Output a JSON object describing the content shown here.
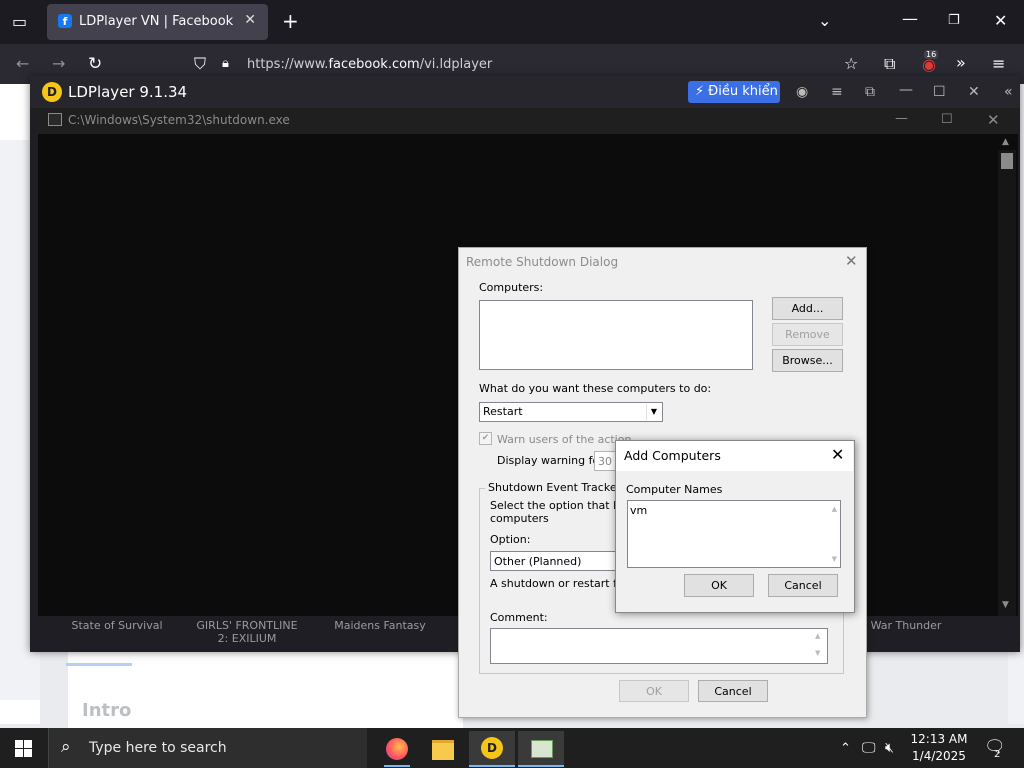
{
  "browser": {
    "tab_title": "LDPlayer VN | Facebook",
    "url_prefix": "https://www.",
    "url_domain": "facebook.com",
    "url_path": "/vi.ldplayer",
    "extension_badge": "16"
  },
  "facebook": {
    "intro_label": "Intro"
  },
  "ldplayer": {
    "title": "LDPlayer 9.1.34",
    "control_button": "Điều khiển",
    "console_title": "C:\\Windows\\System32\\shutdown.exe",
    "games": [
      "State of Survival",
      "GIRLS' FRONTLINE 2: EXILIUM",
      "Maidens Fantasy",
      "War Thunder"
    ]
  },
  "shutdown_dialog": {
    "title": "Remote Shutdown Dialog",
    "computers_label": "Computers:",
    "add_button": "Add...",
    "remove_button": "Remove",
    "browse_button": "Browse...",
    "action_question": "What do you want these computers to do:",
    "action_value": "Restart",
    "warn_label": "Warn users of the action",
    "display_warning_label": "Display warning for",
    "warning_value": "30",
    "tracker_group": "Shutdown Event Tracker",
    "tracker_text_1": "Select the option that best",
    "tracker_text_2": "computers",
    "option_label": "Option:",
    "option_value": "Other (Planned)",
    "description_text": "A shutdown or restart for an",
    "comment_label": "Comment:",
    "ok_button": "OK",
    "cancel_button": "Cancel"
  },
  "add_computers_dialog": {
    "title": "Add Computers",
    "names_label": "Computer Names",
    "names_value": "vm",
    "ok_button": "OK",
    "cancel_button": "Cancel"
  },
  "taskbar": {
    "search_placeholder": "Type here to search",
    "time": "12:13 AM",
    "date": "1/4/2025",
    "notification_count": "2"
  }
}
